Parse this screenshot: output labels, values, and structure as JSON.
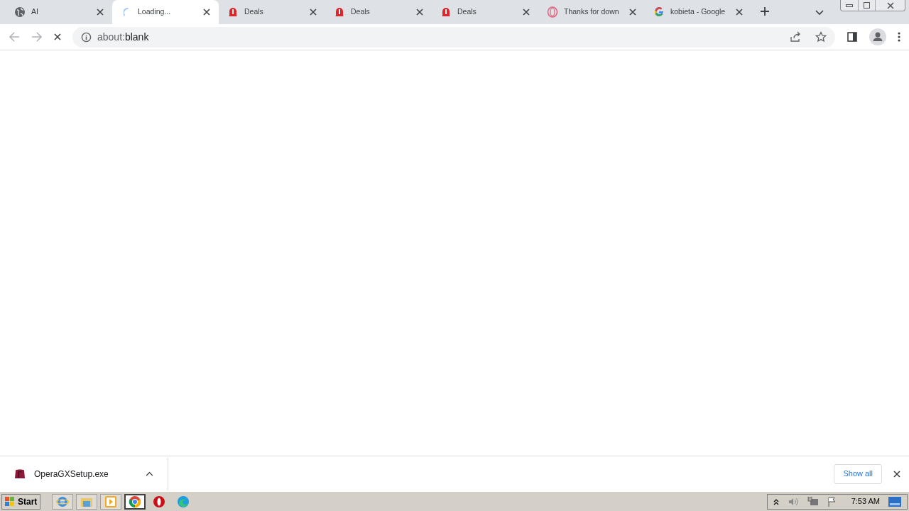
{
  "tabs": [
    {
      "title": "AI",
      "kind": "globe",
      "selected": false
    },
    {
      "title": "Loading...",
      "kind": "spinner",
      "selected": true
    },
    {
      "title": "Deals",
      "kind": "bell",
      "selected": false
    },
    {
      "title": "Deals",
      "kind": "bell",
      "selected": false
    },
    {
      "title": "Deals",
      "kind": "bell",
      "selected": false
    },
    {
      "title": "Thanks for down",
      "kind": "ring",
      "selected": false
    },
    {
      "title": "kobieta - Google",
      "kind": "google",
      "selected": false
    }
  ],
  "address": {
    "scheme": "about:",
    "rest": "blank"
  },
  "downloads": {
    "items": [
      {
        "name": "OperaGXSetup.exe"
      }
    ],
    "show_all": "Show all"
  },
  "taskbar": {
    "start": "Start",
    "apps": [
      {
        "kind": "ie",
        "selected": false
      },
      {
        "kind": "folder",
        "selected": false
      },
      {
        "kind": "media",
        "selected": false
      },
      {
        "kind": "chrome",
        "selected": true
      },
      {
        "kind": "opera",
        "selected": false
      },
      {
        "kind": "edge",
        "selected": false
      }
    ],
    "clock": "7:53 AM"
  }
}
